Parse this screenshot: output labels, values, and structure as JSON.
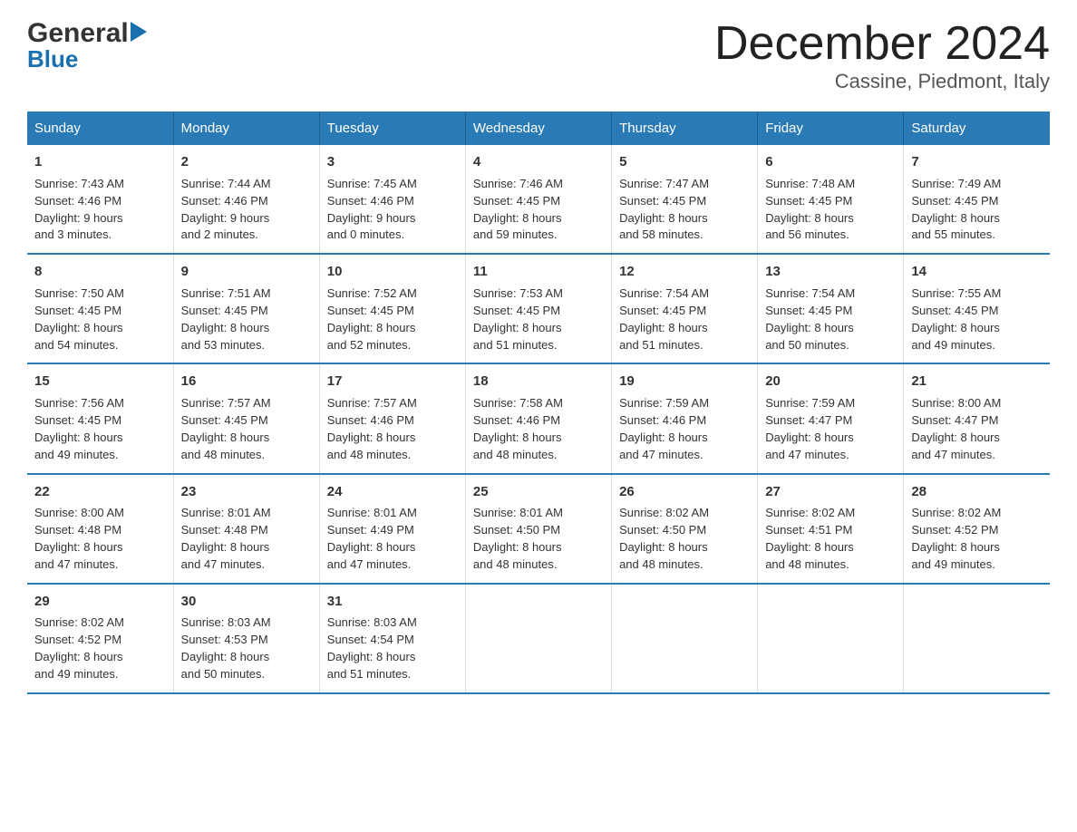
{
  "logo": {
    "general": "General",
    "blue": "Blue"
  },
  "title": "December 2024",
  "subtitle": "Cassine, Piedmont, Italy",
  "days_of_week": [
    "Sunday",
    "Monday",
    "Tuesday",
    "Wednesday",
    "Thursday",
    "Friday",
    "Saturday"
  ],
  "weeks": [
    [
      {
        "day": "1",
        "sunrise": "Sunrise: 7:43 AM",
        "sunset": "Sunset: 4:46 PM",
        "daylight": "Daylight: 9 hours",
        "daylight2": "and 3 minutes."
      },
      {
        "day": "2",
        "sunrise": "Sunrise: 7:44 AM",
        "sunset": "Sunset: 4:46 PM",
        "daylight": "Daylight: 9 hours",
        "daylight2": "and 2 minutes."
      },
      {
        "day": "3",
        "sunrise": "Sunrise: 7:45 AM",
        "sunset": "Sunset: 4:46 PM",
        "daylight": "Daylight: 9 hours",
        "daylight2": "and 0 minutes."
      },
      {
        "day": "4",
        "sunrise": "Sunrise: 7:46 AM",
        "sunset": "Sunset: 4:45 PM",
        "daylight": "Daylight: 8 hours",
        "daylight2": "and 59 minutes."
      },
      {
        "day": "5",
        "sunrise": "Sunrise: 7:47 AM",
        "sunset": "Sunset: 4:45 PM",
        "daylight": "Daylight: 8 hours",
        "daylight2": "and 58 minutes."
      },
      {
        "day": "6",
        "sunrise": "Sunrise: 7:48 AM",
        "sunset": "Sunset: 4:45 PM",
        "daylight": "Daylight: 8 hours",
        "daylight2": "and 56 minutes."
      },
      {
        "day": "7",
        "sunrise": "Sunrise: 7:49 AM",
        "sunset": "Sunset: 4:45 PM",
        "daylight": "Daylight: 8 hours",
        "daylight2": "and 55 minutes."
      }
    ],
    [
      {
        "day": "8",
        "sunrise": "Sunrise: 7:50 AM",
        "sunset": "Sunset: 4:45 PM",
        "daylight": "Daylight: 8 hours",
        "daylight2": "and 54 minutes."
      },
      {
        "day": "9",
        "sunrise": "Sunrise: 7:51 AM",
        "sunset": "Sunset: 4:45 PM",
        "daylight": "Daylight: 8 hours",
        "daylight2": "and 53 minutes."
      },
      {
        "day": "10",
        "sunrise": "Sunrise: 7:52 AM",
        "sunset": "Sunset: 4:45 PM",
        "daylight": "Daylight: 8 hours",
        "daylight2": "and 52 minutes."
      },
      {
        "day": "11",
        "sunrise": "Sunrise: 7:53 AM",
        "sunset": "Sunset: 4:45 PM",
        "daylight": "Daylight: 8 hours",
        "daylight2": "and 51 minutes."
      },
      {
        "day": "12",
        "sunrise": "Sunrise: 7:54 AM",
        "sunset": "Sunset: 4:45 PM",
        "daylight": "Daylight: 8 hours",
        "daylight2": "and 51 minutes."
      },
      {
        "day": "13",
        "sunrise": "Sunrise: 7:54 AM",
        "sunset": "Sunset: 4:45 PM",
        "daylight": "Daylight: 8 hours",
        "daylight2": "and 50 minutes."
      },
      {
        "day": "14",
        "sunrise": "Sunrise: 7:55 AM",
        "sunset": "Sunset: 4:45 PM",
        "daylight": "Daylight: 8 hours",
        "daylight2": "and 49 minutes."
      }
    ],
    [
      {
        "day": "15",
        "sunrise": "Sunrise: 7:56 AM",
        "sunset": "Sunset: 4:45 PM",
        "daylight": "Daylight: 8 hours",
        "daylight2": "and 49 minutes."
      },
      {
        "day": "16",
        "sunrise": "Sunrise: 7:57 AM",
        "sunset": "Sunset: 4:45 PM",
        "daylight": "Daylight: 8 hours",
        "daylight2": "and 48 minutes."
      },
      {
        "day": "17",
        "sunrise": "Sunrise: 7:57 AM",
        "sunset": "Sunset: 4:46 PM",
        "daylight": "Daylight: 8 hours",
        "daylight2": "and 48 minutes."
      },
      {
        "day": "18",
        "sunrise": "Sunrise: 7:58 AM",
        "sunset": "Sunset: 4:46 PM",
        "daylight": "Daylight: 8 hours",
        "daylight2": "and 48 minutes."
      },
      {
        "day": "19",
        "sunrise": "Sunrise: 7:59 AM",
        "sunset": "Sunset: 4:46 PM",
        "daylight": "Daylight: 8 hours",
        "daylight2": "and 47 minutes."
      },
      {
        "day": "20",
        "sunrise": "Sunrise: 7:59 AM",
        "sunset": "Sunset: 4:47 PM",
        "daylight": "Daylight: 8 hours",
        "daylight2": "and 47 minutes."
      },
      {
        "day": "21",
        "sunrise": "Sunrise: 8:00 AM",
        "sunset": "Sunset: 4:47 PM",
        "daylight": "Daylight: 8 hours",
        "daylight2": "and 47 minutes."
      }
    ],
    [
      {
        "day": "22",
        "sunrise": "Sunrise: 8:00 AM",
        "sunset": "Sunset: 4:48 PM",
        "daylight": "Daylight: 8 hours",
        "daylight2": "and 47 minutes."
      },
      {
        "day": "23",
        "sunrise": "Sunrise: 8:01 AM",
        "sunset": "Sunset: 4:48 PM",
        "daylight": "Daylight: 8 hours",
        "daylight2": "and 47 minutes."
      },
      {
        "day": "24",
        "sunrise": "Sunrise: 8:01 AM",
        "sunset": "Sunset: 4:49 PM",
        "daylight": "Daylight: 8 hours",
        "daylight2": "and 47 minutes."
      },
      {
        "day": "25",
        "sunrise": "Sunrise: 8:01 AM",
        "sunset": "Sunset: 4:50 PM",
        "daylight": "Daylight: 8 hours",
        "daylight2": "and 48 minutes."
      },
      {
        "day": "26",
        "sunrise": "Sunrise: 8:02 AM",
        "sunset": "Sunset: 4:50 PM",
        "daylight": "Daylight: 8 hours",
        "daylight2": "and 48 minutes."
      },
      {
        "day": "27",
        "sunrise": "Sunrise: 8:02 AM",
        "sunset": "Sunset: 4:51 PM",
        "daylight": "Daylight: 8 hours",
        "daylight2": "and 48 minutes."
      },
      {
        "day": "28",
        "sunrise": "Sunrise: 8:02 AM",
        "sunset": "Sunset: 4:52 PM",
        "daylight": "Daylight: 8 hours",
        "daylight2": "and 49 minutes."
      }
    ],
    [
      {
        "day": "29",
        "sunrise": "Sunrise: 8:02 AM",
        "sunset": "Sunset: 4:52 PM",
        "daylight": "Daylight: 8 hours",
        "daylight2": "and 49 minutes."
      },
      {
        "day": "30",
        "sunrise": "Sunrise: 8:03 AM",
        "sunset": "Sunset: 4:53 PM",
        "daylight": "Daylight: 8 hours",
        "daylight2": "and 50 minutes."
      },
      {
        "day": "31",
        "sunrise": "Sunrise: 8:03 AM",
        "sunset": "Sunset: 4:54 PM",
        "daylight": "Daylight: 8 hours",
        "daylight2": "and 51 minutes."
      },
      {
        "day": "",
        "sunrise": "",
        "sunset": "",
        "daylight": "",
        "daylight2": ""
      },
      {
        "day": "",
        "sunrise": "",
        "sunset": "",
        "daylight": "",
        "daylight2": ""
      },
      {
        "day": "",
        "sunrise": "",
        "sunset": "",
        "daylight": "",
        "daylight2": ""
      },
      {
        "day": "",
        "sunrise": "",
        "sunset": "",
        "daylight": "",
        "daylight2": ""
      }
    ]
  ]
}
